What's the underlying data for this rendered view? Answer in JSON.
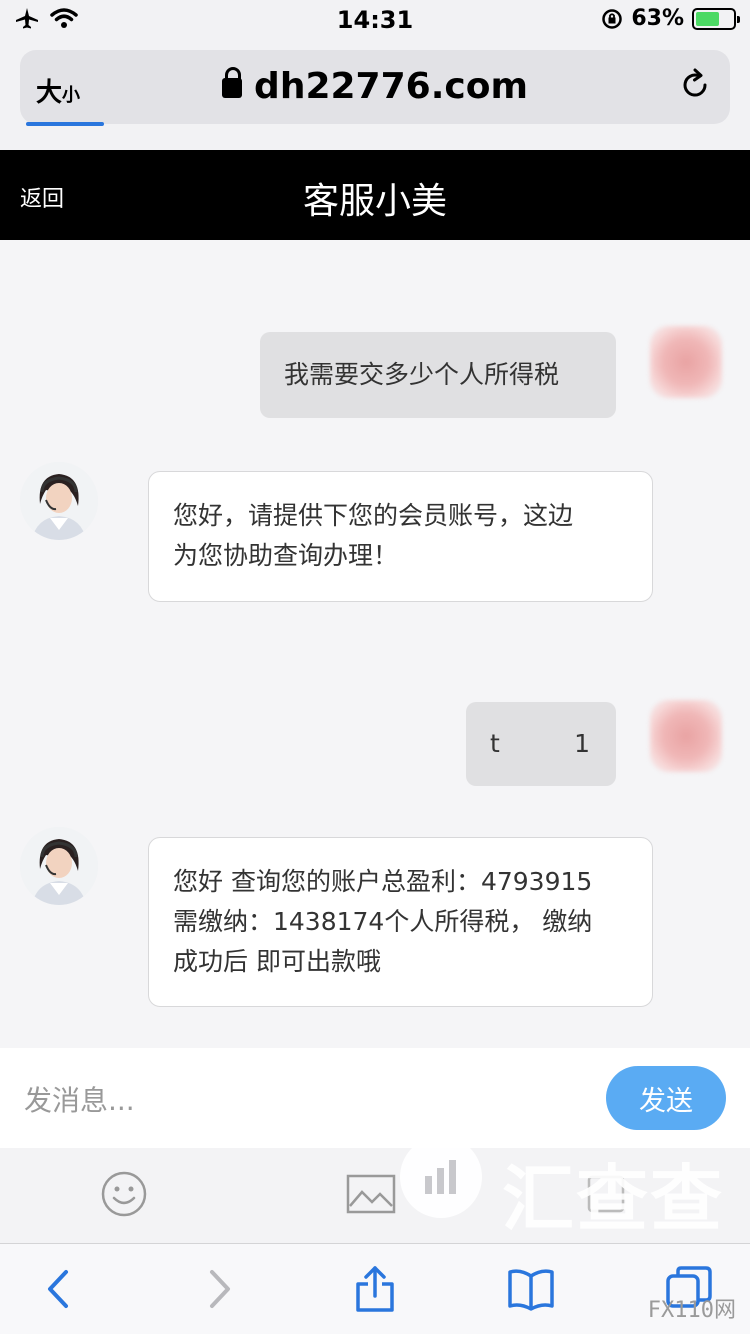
{
  "status_bar": {
    "time": "14:31",
    "battery": "63%"
  },
  "browser": {
    "text_size_button": "大",
    "text_size_small": "小",
    "url": "dh22776.com"
  },
  "chat": {
    "back_label": "返回",
    "title": "客服小美"
  },
  "messages": [
    {
      "side": "out",
      "text": "我需要交多少个人所得税"
    },
    {
      "side": "in",
      "lines": [
        "您好，请提供下您的会员账号，这边",
        "为您协助查询办理！"
      ]
    },
    {
      "side": "out",
      "text_left": "t",
      "text_right": "1"
    },
    {
      "side": "in",
      "lines": [
        "您好 查询您的账户总盈利：4793915",
        "需缴纳：1438174个人所得税， 缴纳",
        "成功后 即可出款哦"
      ]
    }
  ],
  "composer": {
    "placeholder": "发消息...",
    "send_label": "发送"
  },
  "watermark": {
    "brand": "汇查查",
    "corner": "FX110网"
  },
  "colors": {
    "header": "#000000",
    "send_button": "#5aabf3",
    "toolbar_icons": "#2a76dd",
    "progress": "#2a76dd"
  }
}
